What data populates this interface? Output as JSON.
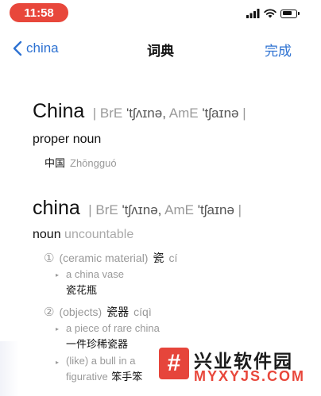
{
  "status_bar": {
    "time": "11:58"
  },
  "nav": {
    "back_label": "china",
    "title": "词典",
    "done_label": "完成"
  },
  "entries": [
    {
      "headword": "China",
      "bre_label": "BrE",
      "bre_ipa": "'tʃʌɪnə,",
      "ame_label": "AmE",
      "ame_ipa": "'tʃaɪnə",
      "pos": "proper noun",
      "translation": "中国",
      "pinyin": "Zhōngguó"
    },
    {
      "headword": "china",
      "bre_label": "BrE",
      "bre_ipa": "'tʃʌɪnə,",
      "ame_label": "AmE",
      "ame_ipa": "'tʃaɪnə",
      "pos": "noun",
      "pos_qualifier": "uncountable",
      "senses": [
        {
          "number": "①",
          "gloss": "(ceramic material)",
          "cn": "瓷",
          "pinyin": "cí",
          "examples": [
            {
              "en": "a china vase",
              "cn": "瓷花瓶"
            }
          ]
        },
        {
          "number": "②",
          "gloss": "(objects)",
          "cn": "瓷器",
          "pinyin": "cíqì",
          "examples": [
            {
              "en": "a piece of rare china",
              "cn": "一件珍稀瓷器"
            },
            {
              "en": "(like) a bull in a",
              "label": "figurative",
              "cn": "笨手笨"
            }
          ]
        }
      ]
    }
  ],
  "watermark": {
    "mark": "#",
    "name": "兴业软件园",
    "domain": "MYXYJS.COM"
  }
}
